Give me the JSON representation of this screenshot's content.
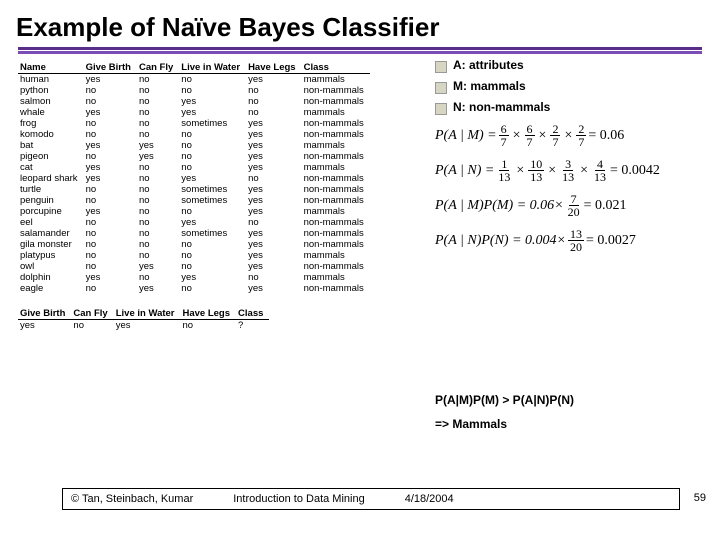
{
  "title": "Example of Naïve Bayes Classifier",
  "defs": {
    "a": "A: attributes",
    "m": "M: mammals",
    "n": "N: non-mammals"
  },
  "table": {
    "headers": [
      "Name",
      "Give Birth",
      "Can Fly",
      "Live in Water",
      "Have Legs",
      "Class"
    ],
    "rows": [
      [
        "human",
        "yes",
        "no",
        "no",
        "yes",
        "mammals"
      ],
      [
        "python",
        "no",
        "no",
        "no",
        "no",
        "non-mammals"
      ],
      [
        "salmon",
        "no",
        "no",
        "yes",
        "no",
        "non-mammals"
      ],
      [
        "whale",
        "yes",
        "no",
        "yes",
        "no",
        "mammals"
      ],
      [
        "frog",
        "no",
        "no",
        "sometimes",
        "yes",
        "non-mammals"
      ],
      [
        "komodo",
        "no",
        "no",
        "no",
        "yes",
        "non-mammals"
      ],
      [
        "bat",
        "yes",
        "yes",
        "no",
        "yes",
        "mammals"
      ],
      [
        "pigeon",
        "no",
        "yes",
        "no",
        "yes",
        "non-mammals"
      ],
      [
        "cat",
        "yes",
        "no",
        "no",
        "yes",
        "mammals"
      ],
      [
        "leopard shark",
        "yes",
        "no",
        "yes",
        "no",
        "non-mammals"
      ],
      [
        "turtle",
        "no",
        "no",
        "sometimes",
        "yes",
        "non-mammals"
      ],
      [
        "penguin",
        "no",
        "no",
        "sometimes",
        "yes",
        "non-mammals"
      ],
      [
        "porcupine",
        "yes",
        "no",
        "no",
        "yes",
        "mammals"
      ],
      [
        "eel",
        "no",
        "no",
        "yes",
        "no",
        "non-mammals"
      ],
      [
        "salamander",
        "no",
        "no",
        "sometimes",
        "yes",
        "non-mammals"
      ],
      [
        "gila monster",
        "no",
        "no",
        "no",
        "yes",
        "non-mammals"
      ],
      [
        "platypus",
        "no",
        "no",
        "no",
        "yes",
        "mammals"
      ],
      [
        "owl",
        "no",
        "yes",
        "no",
        "yes",
        "non-mammals"
      ],
      [
        "dolphin",
        "yes",
        "no",
        "yes",
        "no",
        "mammals"
      ],
      [
        "eagle",
        "no",
        "yes",
        "no",
        "yes",
        "non-mammals"
      ]
    ]
  },
  "test": {
    "headers": [
      "Give Birth",
      "Can Fly",
      "Live in Water",
      "Have Legs",
      "Class"
    ],
    "row": [
      "yes",
      "no",
      "yes",
      "no",
      "?"
    ]
  },
  "formulas": {
    "f1": {
      "lhs": "P(A | M)",
      "fracs": [
        [
          "6",
          "7"
        ],
        [
          "6",
          "7"
        ],
        [
          "2",
          "7"
        ],
        [
          "2",
          "7"
        ]
      ],
      "rhs": "0.06"
    },
    "f2": {
      "lhs": "P(A | N)",
      "fracs": [
        [
          "1",
          "13"
        ],
        [
          "10",
          "13"
        ],
        [
          "3",
          "13"
        ],
        [
          "4",
          "13"
        ]
      ],
      "rhs": "0.0042"
    },
    "f3": {
      "lhs": "P(A | M)P(M)",
      "val": "0.06",
      "frac": [
        "7",
        "20"
      ],
      "rhs": "0.021"
    },
    "f4": {
      "lhs": "P(A | N)P(N)",
      "val": "0.004",
      "frac": [
        "13",
        "20"
      ],
      "rhs": "0.0027"
    }
  },
  "conclusion": {
    "inequality": "P(A|M)P(M) > P(A|N)P(N)",
    "result": "=> Mammals"
  },
  "footer": {
    "copyright": "© Tan, Steinbach, Kumar",
    "course": "Introduction to Data Mining",
    "date": "4/18/2004"
  },
  "pagenum": "59"
}
